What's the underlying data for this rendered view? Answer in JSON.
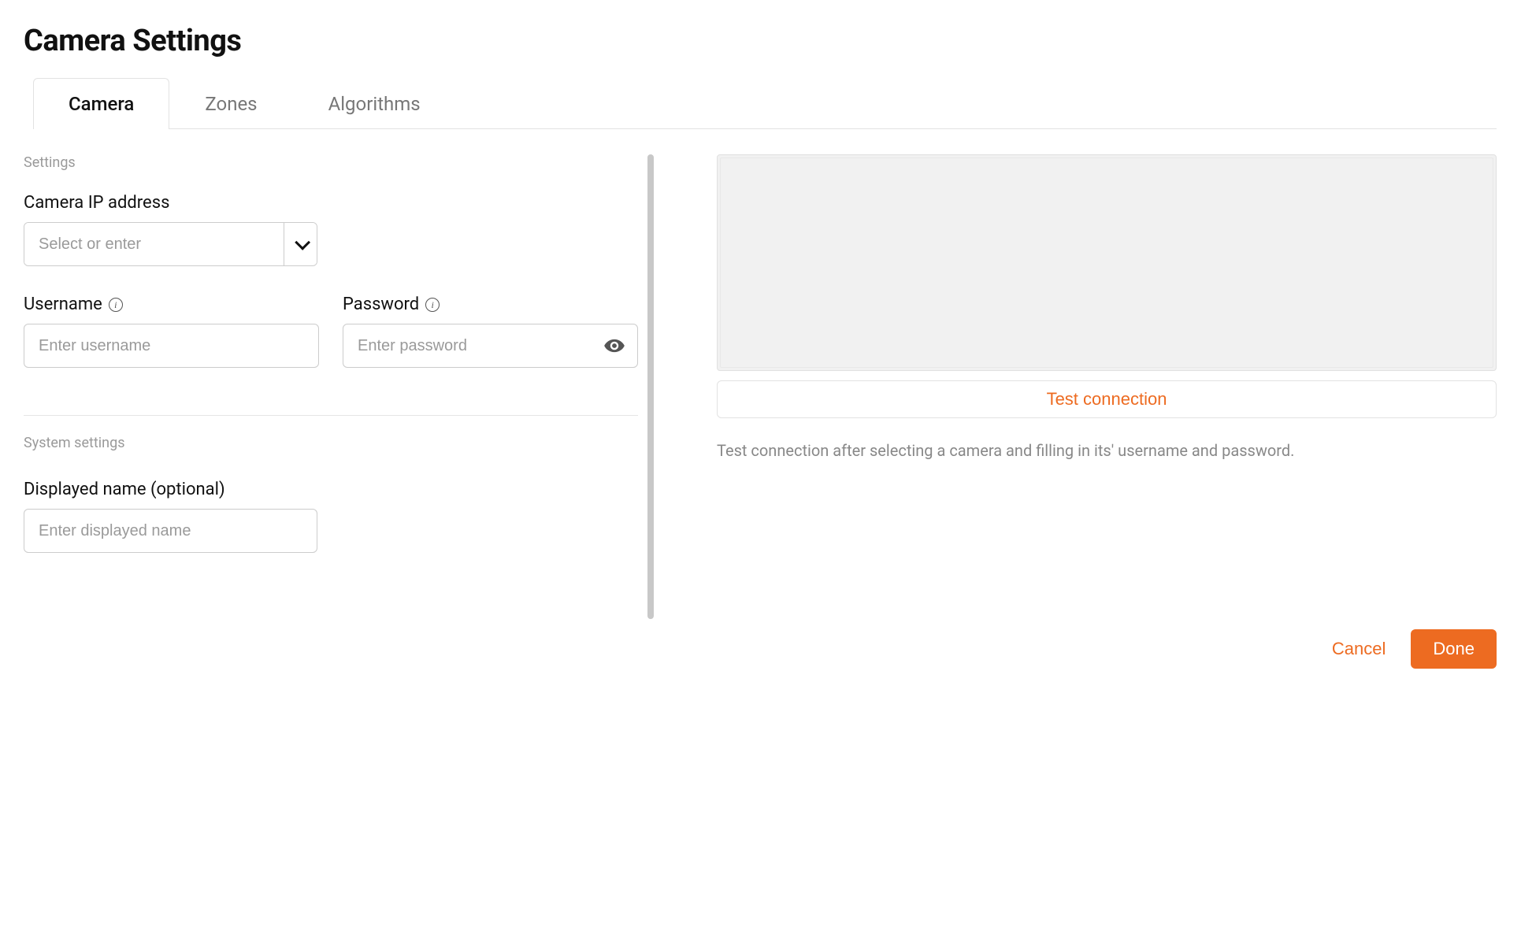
{
  "title": "Camera Settings",
  "tabs": [
    {
      "label": "Camera",
      "active": true
    },
    {
      "label": "Zones",
      "active": false
    },
    {
      "label": "Algorithms",
      "active": false
    }
  ],
  "sections": {
    "settings_label": "Settings",
    "system_label": "System settings"
  },
  "fields": {
    "ip": {
      "label": "Camera IP address",
      "placeholder": "Select or enter",
      "value": ""
    },
    "username": {
      "label": "Username",
      "placeholder": "Enter username",
      "value": ""
    },
    "password": {
      "label": "Password",
      "placeholder": "Enter password",
      "value": ""
    },
    "displayed_name": {
      "label": "Displayed name (optional)",
      "placeholder": "Enter displayed name",
      "value": ""
    }
  },
  "right": {
    "test_button": "Test connection",
    "help_text": "Test connection after selecting a camera and filling in its' username and password."
  },
  "actions": {
    "cancel": "Cancel",
    "done": "Done"
  },
  "icons": {
    "info": "i"
  }
}
